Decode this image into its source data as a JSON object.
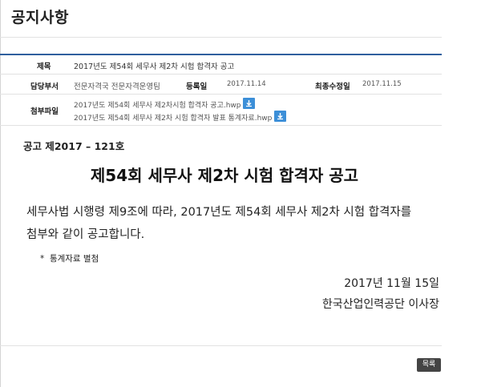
{
  "page": {
    "title": "공지사항"
  },
  "info": {
    "subject_label": "제목",
    "subject": "2017년도 제54회 세무사 제2차 시험 합격자 공고",
    "department_label": "담당부서",
    "department": "전문자격국 전문자격운영팀",
    "registered_label": "등록일",
    "registered": "2017.11.14",
    "modified_label": "최종수정일",
    "modified": "2017.11.15",
    "attachments_label": "첨부파일",
    "attachments": [
      {
        "name": "2017년도 제54회 세무사 제2차시험 합격자 공고.hwp",
        "icon": "download-icon"
      },
      {
        "name": "2017년도 제54회 세무사 제2차 시험 합격자 발표 통계자료.hwp",
        "icon": "download-icon"
      }
    ]
  },
  "notice": {
    "number": "공고 제2017 – 121호",
    "title": "제54회 세무사 제2차 시험 합격자 공고",
    "body": "세무사법 시행령 제9조에 따라, 2017년도 제54회 세무사 제2차 시험 합격자를 첨부와 같이 공고합니다.",
    "bullet": "통계자료 별첨",
    "date": "2017년 11월 15일",
    "issuer": "한국산업인력공단 이사장"
  },
  "footer": {
    "list_button": "목록"
  },
  "colors": {
    "accent": "#2f5f9e",
    "download": "#3c8fd8",
    "button": "#444444"
  }
}
